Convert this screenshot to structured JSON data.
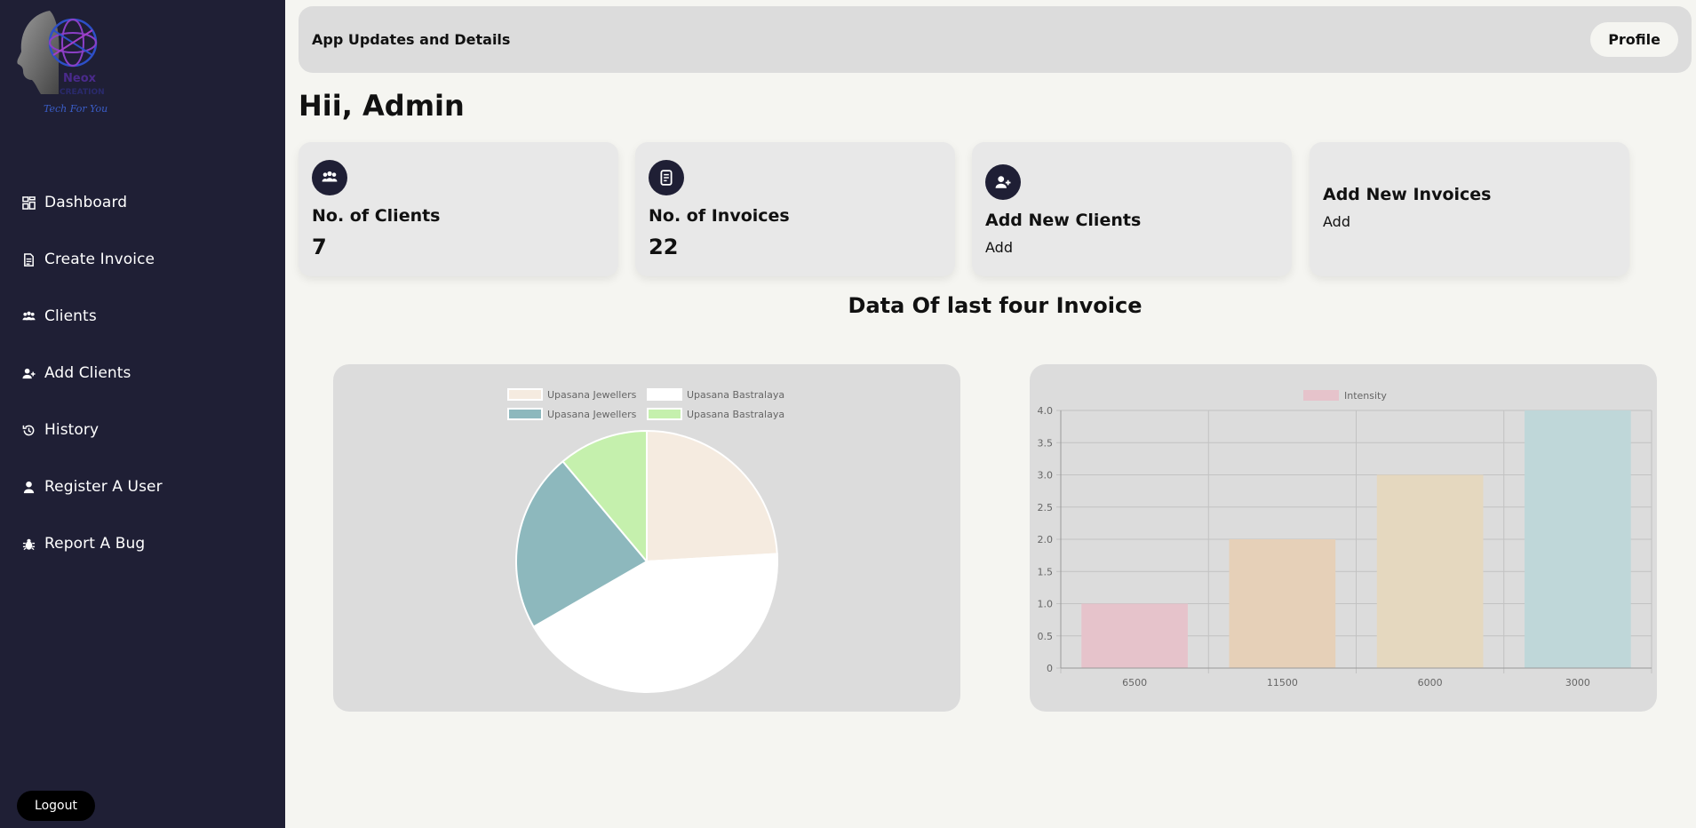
{
  "logo": {
    "text_line1": "Neox",
    "text_line2": "CREATION",
    "tagline": "Tech For You"
  },
  "sidebar": {
    "items": [
      {
        "label": "Dashboard",
        "icon": "dashboard-icon"
      },
      {
        "label": "Create Invoice",
        "icon": "document-icon"
      },
      {
        "label": "Clients",
        "icon": "users-icon"
      },
      {
        "label": "Add Clients",
        "icon": "user-plus-icon"
      },
      {
        "label": "History",
        "icon": "history-icon"
      },
      {
        "label": "Register A User",
        "icon": "user-icon"
      },
      {
        "label": "Report A Bug",
        "icon": "bug-icon"
      }
    ],
    "logout_label": "Logout"
  },
  "topbar": {
    "title": "App Updates and Details",
    "profile_label": "Profile"
  },
  "greeting": "Hii, Admin",
  "cards": [
    {
      "title": "No. of Clients",
      "value": "7",
      "icon": "users-icon"
    },
    {
      "title": "No. of Invoices",
      "value": "22",
      "icon": "invoice-icon"
    },
    {
      "title": "Add New Clients",
      "sub": "Add",
      "icon": "user-plus-icon"
    },
    {
      "title": "Add New Invoices",
      "sub": "Add"
    }
  ],
  "section_title": "Data Of last four Invoice",
  "colors": {
    "sidebar_bg": "#1f1f35",
    "panel_bg": "#dcdcdc",
    "page_bg": "#f5f5f1"
  },
  "chart_data": [
    {
      "type": "pie",
      "labels": [
        "Upasana Jewellers",
        "Upasana Bastralaya",
        "Upasana Jewellers",
        "Upasana Bastralaya"
      ],
      "values": [
        6500,
        11500,
        6000,
        3000
      ],
      "colors": [
        "#f5ebe0",
        "#ffffff",
        "#8db8bd",
        "#c5f0ad"
      ],
      "legend": "top"
    },
    {
      "type": "bar",
      "categories": [
        "6500",
        "11500",
        "6000",
        "3000"
      ],
      "series": [
        {
          "name": "Intensity",
          "values": [
            1,
            2,
            3,
            4
          ]
        }
      ],
      "bar_colors": [
        "#e6c3cb",
        "#e6d0b8",
        "#e5d8bf",
        "#bfd7d9"
      ],
      "ylim": [
        0,
        4
      ],
      "yticks": [
        "0",
        "0.5",
        "1.0",
        "1.5",
        "2.0",
        "2.5",
        "3.0",
        "3.5",
        "4.0"
      ],
      "grid": true,
      "legend": "top"
    }
  ]
}
